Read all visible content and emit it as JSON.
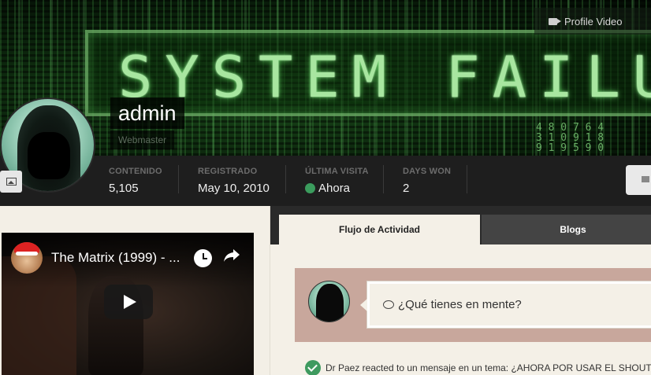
{
  "cover": {
    "banner_text": "SYSTEM FAILURE",
    "digits": "4 8 0 7 6 4\n3 1 0 9 1 8\n9 1 9 5 9 0",
    "profile_video_label": "Profile Video"
  },
  "profile": {
    "username": "admin",
    "role": "Webmaster"
  },
  "stats": {
    "content_label": "CONTENIDO",
    "content_value": "5,105",
    "registered_label": "REGISTRADO",
    "registered_value": "May 10, 2010",
    "last_visit_label": "ÚLTIMA VISITA",
    "last_visit_value": "Ahora",
    "days_won_label": "DAYS WON",
    "days_won_value": "2"
  },
  "video": {
    "title": "The Matrix (1999) - ..."
  },
  "tabs": [
    {
      "label": "Flujo de Actividad"
    },
    {
      "label": "Blogs"
    }
  ],
  "composer": {
    "placeholder": "¿Qué tienes en mente?"
  },
  "activity": {
    "text": "Dr Paez reacted to un mensaje en un tema: ¿AHORA POR USAR EL SHOUTBOX"
  },
  "colors": {
    "online": "#3b9c5d",
    "stats_bar": "#1e1e1e",
    "composer_bg": "#c8a79c"
  }
}
